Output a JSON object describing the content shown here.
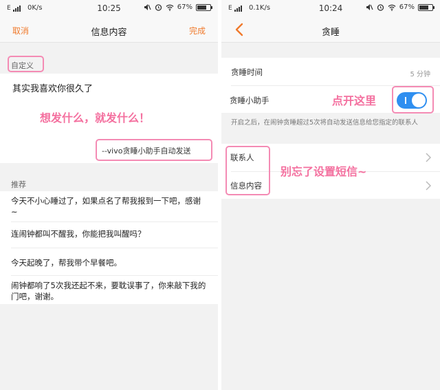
{
  "left": {
    "status": {
      "carrier": "E",
      "speed": "0K/s",
      "time": "10:25",
      "battery": "67%"
    },
    "nav": {
      "cancel": "取消",
      "title": "信息内容",
      "done": "完成"
    },
    "custom_label": "自定义",
    "message": "其实我喜欢你很久了",
    "annotation": "想发什么，就发什么！",
    "signature": "--vivo贪睡小助手自动发送",
    "recommend_label": "推荐",
    "recommendations": [
      "今天不小心睡过了，如果点名了帮我报到一下吧，感谢~",
      "连闹钟都叫不醒我，你能把我叫醒吗？",
      "今天起晚了，帮我带个早餐吧。",
      "闹钟都响了5次我还起不来，要耽误事了，你来敲下我的门吧，谢谢。"
    ]
  },
  "right": {
    "status": {
      "carrier": "E",
      "speed": "0.1K/s",
      "time": "10:24",
      "battery": "67%"
    },
    "nav": {
      "title": "贪睡"
    },
    "snooze_time_label": "贪睡时间",
    "snooze_time_value": "5 分钟",
    "assistant_label": "贪睡小助手",
    "assistant_on": true,
    "annotation_toggle": "点开这里",
    "hint": "开启之后，在闹钟贪睡超过5次将自动发送信息给您指定的联系人",
    "contacts_label": "联系人",
    "message_label": "信息内容",
    "annotation_sms": "别忘了设置短信~"
  },
  "colors": {
    "accent": "#f07a2c",
    "toggle": "#2f8ff0",
    "annotation": "#f4709f"
  },
  "icons": [
    "signal-icon",
    "mute-icon",
    "alarm-icon",
    "wifi-icon",
    "battery-icon",
    "back-icon",
    "chevron-right-icon"
  ]
}
